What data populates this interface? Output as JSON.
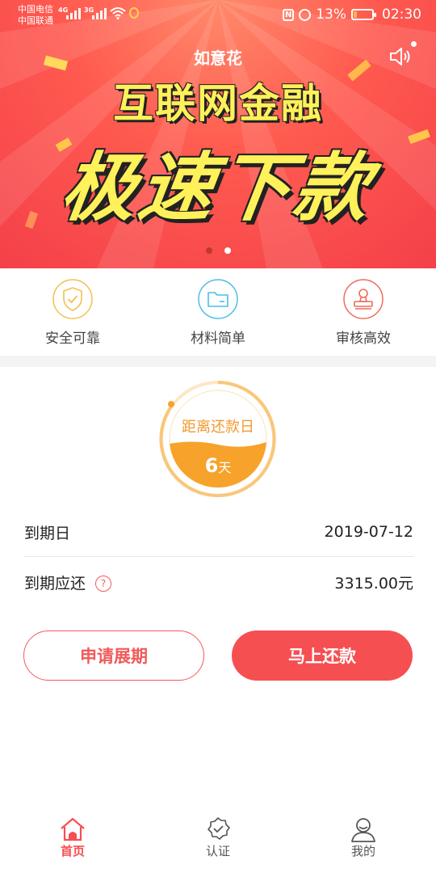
{
  "status_bar": {
    "carrier1": "中国电信",
    "carrier2": "中国联通",
    "net1": "4G",
    "net2": "3G",
    "battery_text": "13%",
    "time": "02:30"
  },
  "header": {
    "title": "如意花"
  },
  "banner": {
    "line1": "互联网金融",
    "line2": "极速下款",
    "active_slide": 1,
    "slide_count": 2
  },
  "features": [
    {
      "label": "安全可靠",
      "icon": "shield-check-icon",
      "color": "#f2c14e"
    },
    {
      "label": "材料简单",
      "icon": "folder-icon",
      "color": "#4dbde8"
    },
    {
      "label": "审核高效",
      "icon": "stamp-icon",
      "color": "#ec6c5c"
    }
  ],
  "countdown": {
    "label": "距离还款日",
    "days": "6",
    "unit": "天"
  },
  "info": {
    "due_date_label": "到期日",
    "due_date_value": "2019-07-12",
    "due_amount_label": "到期应还",
    "due_amount_value": "3315.00元",
    "help_symbol": "?"
  },
  "actions": {
    "extend_label": "申请展期",
    "repay_label": "马上还款"
  },
  "tabbar": {
    "tabs": [
      {
        "label": "首页",
        "icon": "home-icon",
        "active": true
      },
      {
        "label": "认证",
        "icon": "verified-badge-icon",
        "active": false
      },
      {
        "label": "我的",
        "icon": "user-icon",
        "active": false
      }
    ]
  },
  "colors": {
    "accent": "#f64f51",
    "countdown_orange": "#f7a22a",
    "tab_inactive": "#555555"
  }
}
